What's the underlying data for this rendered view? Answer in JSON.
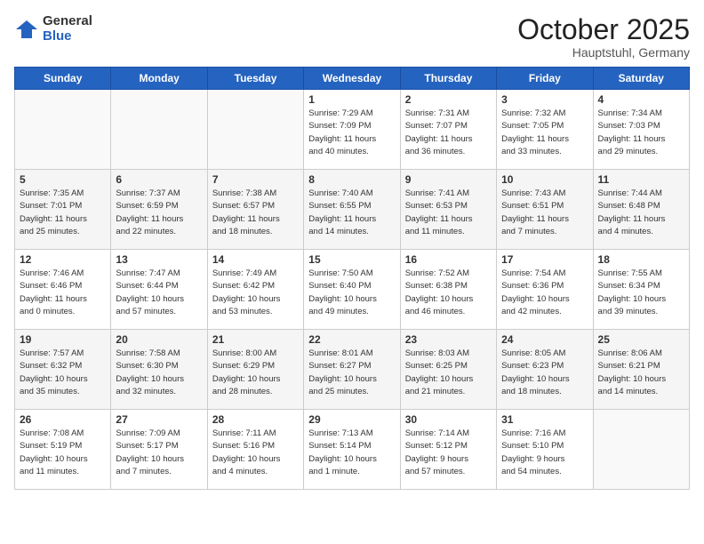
{
  "logo": {
    "general": "General",
    "blue": "Blue"
  },
  "title": "October 2025",
  "location": "Hauptstuhl, Germany",
  "weekdays": [
    "Sunday",
    "Monday",
    "Tuesday",
    "Wednesday",
    "Thursday",
    "Friday",
    "Saturday"
  ],
  "weeks": [
    [
      {
        "day": "",
        "info": ""
      },
      {
        "day": "",
        "info": ""
      },
      {
        "day": "",
        "info": ""
      },
      {
        "day": "1",
        "info": "Sunrise: 7:29 AM\nSunset: 7:09 PM\nDaylight: 11 hours\nand 40 minutes."
      },
      {
        "day": "2",
        "info": "Sunrise: 7:31 AM\nSunset: 7:07 PM\nDaylight: 11 hours\nand 36 minutes."
      },
      {
        "day": "3",
        "info": "Sunrise: 7:32 AM\nSunset: 7:05 PM\nDaylight: 11 hours\nand 33 minutes."
      },
      {
        "day": "4",
        "info": "Sunrise: 7:34 AM\nSunset: 7:03 PM\nDaylight: 11 hours\nand 29 minutes."
      }
    ],
    [
      {
        "day": "5",
        "info": "Sunrise: 7:35 AM\nSunset: 7:01 PM\nDaylight: 11 hours\nand 25 minutes."
      },
      {
        "day": "6",
        "info": "Sunrise: 7:37 AM\nSunset: 6:59 PM\nDaylight: 11 hours\nand 22 minutes."
      },
      {
        "day": "7",
        "info": "Sunrise: 7:38 AM\nSunset: 6:57 PM\nDaylight: 11 hours\nand 18 minutes."
      },
      {
        "day": "8",
        "info": "Sunrise: 7:40 AM\nSunset: 6:55 PM\nDaylight: 11 hours\nand 14 minutes."
      },
      {
        "day": "9",
        "info": "Sunrise: 7:41 AM\nSunset: 6:53 PM\nDaylight: 11 hours\nand 11 minutes."
      },
      {
        "day": "10",
        "info": "Sunrise: 7:43 AM\nSunset: 6:51 PM\nDaylight: 11 hours\nand 7 minutes."
      },
      {
        "day": "11",
        "info": "Sunrise: 7:44 AM\nSunset: 6:48 PM\nDaylight: 11 hours\nand 4 minutes."
      }
    ],
    [
      {
        "day": "12",
        "info": "Sunrise: 7:46 AM\nSunset: 6:46 PM\nDaylight: 11 hours\nand 0 minutes."
      },
      {
        "day": "13",
        "info": "Sunrise: 7:47 AM\nSunset: 6:44 PM\nDaylight: 10 hours\nand 57 minutes."
      },
      {
        "day": "14",
        "info": "Sunrise: 7:49 AM\nSunset: 6:42 PM\nDaylight: 10 hours\nand 53 minutes."
      },
      {
        "day": "15",
        "info": "Sunrise: 7:50 AM\nSunset: 6:40 PM\nDaylight: 10 hours\nand 49 minutes."
      },
      {
        "day": "16",
        "info": "Sunrise: 7:52 AM\nSunset: 6:38 PM\nDaylight: 10 hours\nand 46 minutes."
      },
      {
        "day": "17",
        "info": "Sunrise: 7:54 AM\nSunset: 6:36 PM\nDaylight: 10 hours\nand 42 minutes."
      },
      {
        "day": "18",
        "info": "Sunrise: 7:55 AM\nSunset: 6:34 PM\nDaylight: 10 hours\nand 39 minutes."
      }
    ],
    [
      {
        "day": "19",
        "info": "Sunrise: 7:57 AM\nSunset: 6:32 PM\nDaylight: 10 hours\nand 35 minutes."
      },
      {
        "day": "20",
        "info": "Sunrise: 7:58 AM\nSunset: 6:30 PM\nDaylight: 10 hours\nand 32 minutes."
      },
      {
        "day": "21",
        "info": "Sunrise: 8:00 AM\nSunset: 6:29 PM\nDaylight: 10 hours\nand 28 minutes."
      },
      {
        "day": "22",
        "info": "Sunrise: 8:01 AM\nSunset: 6:27 PM\nDaylight: 10 hours\nand 25 minutes."
      },
      {
        "day": "23",
        "info": "Sunrise: 8:03 AM\nSunset: 6:25 PM\nDaylight: 10 hours\nand 21 minutes."
      },
      {
        "day": "24",
        "info": "Sunrise: 8:05 AM\nSunset: 6:23 PM\nDaylight: 10 hours\nand 18 minutes."
      },
      {
        "day": "25",
        "info": "Sunrise: 8:06 AM\nSunset: 6:21 PM\nDaylight: 10 hours\nand 14 minutes."
      }
    ],
    [
      {
        "day": "26",
        "info": "Sunrise: 7:08 AM\nSunset: 5:19 PM\nDaylight: 10 hours\nand 11 minutes."
      },
      {
        "day": "27",
        "info": "Sunrise: 7:09 AM\nSunset: 5:17 PM\nDaylight: 10 hours\nand 7 minutes."
      },
      {
        "day": "28",
        "info": "Sunrise: 7:11 AM\nSunset: 5:16 PM\nDaylight: 10 hours\nand 4 minutes."
      },
      {
        "day": "29",
        "info": "Sunrise: 7:13 AM\nSunset: 5:14 PM\nDaylight: 10 hours\nand 1 minute."
      },
      {
        "day": "30",
        "info": "Sunrise: 7:14 AM\nSunset: 5:12 PM\nDaylight: 9 hours\nand 57 minutes."
      },
      {
        "day": "31",
        "info": "Sunrise: 7:16 AM\nSunset: 5:10 PM\nDaylight: 9 hours\nand 54 minutes."
      },
      {
        "day": "",
        "info": ""
      }
    ]
  ]
}
